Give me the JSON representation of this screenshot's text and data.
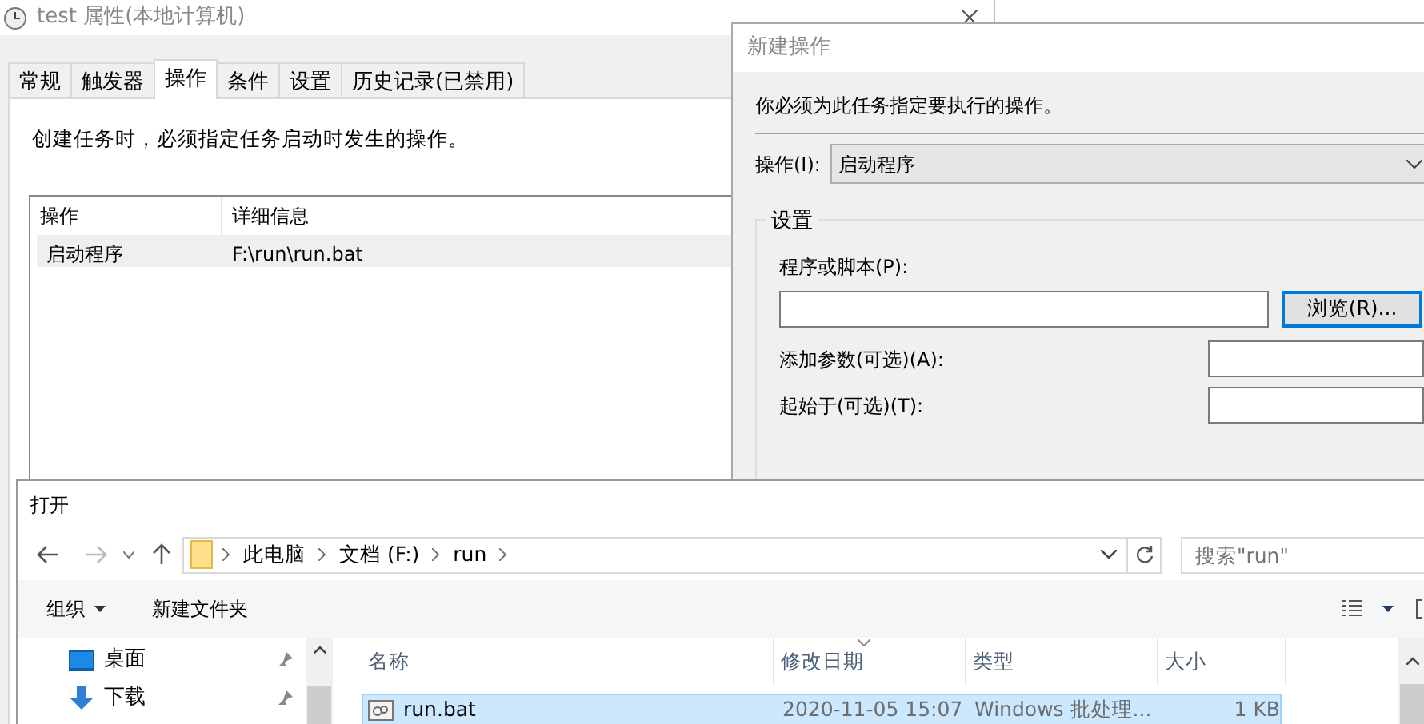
{
  "properties_window": {
    "title": "test 属性(本地计算机)",
    "tabs": [
      {
        "label": "常规",
        "selected": false
      },
      {
        "label": "触发器",
        "selected": false
      },
      {
        "label": "操作",
        "selected": true
      },
      {
        "label": "条件",
        "selected": false
      },
      {
        "label": "设置",
        "selected": false
      },
      {
        "label": "历史记录(已禁用)",
        "selected": false
      }
    ],
    "description": "创建任务时，必须指定任务启动时发生的操作。",
    "actions_table": {
      "columns": [
        "操作",
        "详细信息"
      ],
      "rows": [
        {
          "cells": [
            "启动程序",
            "F:\\run\\run.bat"
          ],
          "selected": true
        }
      ]
    }
  },
  "new_action_dialog": {
    "title": "新建操作",
    "instruction": "你必须为此任务指定要执行的操作。",
    "action_label": "操作(I):",
    "action_value": "启动程序",
    "settings_group": "设置",
    "program_label": "程序或脚本(P):",
    "browse_button": {
      "label": "浏览(R)...",
      "focused": true
    },
    "arguments_label": "添加参数(可选)(A):",
    "start_in_label": "起始于(可选)(T):"
  },
  "open_dialog": {
    "title": "打开",
    "breadcrumbs": [
      "此电脑",
      "文档 (F:)",
      "run"
    ],
    "search_placeholder": "搜索\"run\"",
    "toolbar": {
      "organize": "组织",
      "new_folder": "新建文件夹"
    },
    "nav_items": [
      {
        "label": "桌面",
        "kind": "desktop",
        "pinned": true
      },
      {
        "label": "下载",
        "kind": "download",
        "pinned": true
      }
    ],
    "columns": [
      {
        "label": "名称",
        "sorted": false
      },
      {
        "label": "修改日期",
        "sorted": true
      },
      {
        "label": "类型",
        "sorted": false
      },
      {
        "label": "大小",
        "sorted": false
      }
    ],
    "files": [
      {
        "name": "run.bat",
        "modified": "2020-11-05 15:07",
        "type": "Windows 批处理...",
        "size": "1 KB",
        "selected": true
      }
    ]
  }
}
